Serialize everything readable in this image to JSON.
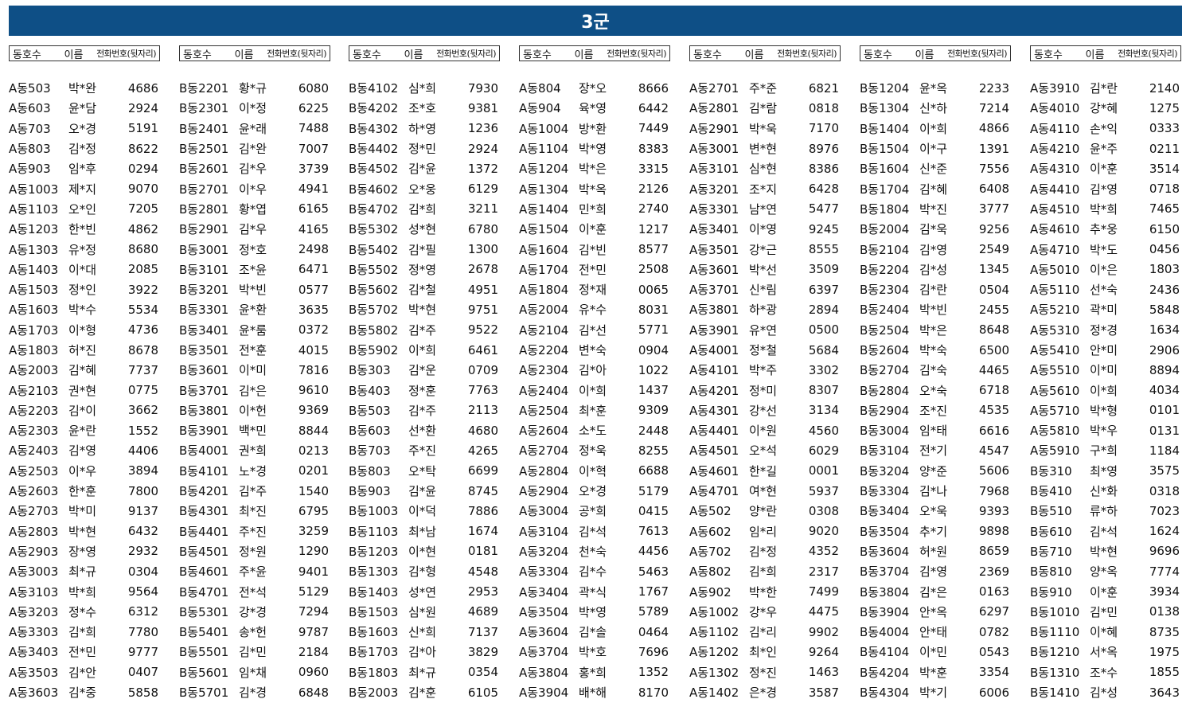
{
  "title": "3군",
  "header": {
    "unit": "동호수",
    "name": "이름",
    "phone": "전화번호(뒷자리)"
  },
  "columns": [
    [
      [
        "A동503",
        "박*완",
        "4686"
      ],
      [
        "A동603",
        "윤*담",
        "2924"
      ],
      [
        "A동703",
        "오*경",
        "5191"
      ],
      [
        "A동803",
        "김*정",
        "8622"
      ],
      [
        "A동903",
        "임*후",
        "0294"
      ],
      [
        "A동1003",
        "제*지",
        "9070"
      ],
      [
        "A동1103",
        "오*인",
        "7205"
      ],
      [
        "A동1203",
        "한*빈",
        "4862"
      ],
      [
        "A동1303",
        "유*정",
        "8680"
      ],
      [
        "A동1403",
        "이*대",
        "2085"
      ],
      [
        "A동1503",
        "정*인",
        "3922"
      ],
      [
        "A동1603",
        "박*수",
        "5534"
      ],
      [
        "A동1703",
        "이*형",
        "4736"
      ],
      [
        "A동1803",
        "허*진",
        "8678"
      ],
      [
        "A동2003",
        "김*혜",
        "7737"
      ],
      [
        "A동2103",
        "권*현",
        "0775"
      ],
      [
        "A동2203",
        "김*이",
        "3662"
      ],
      [
        "A동2303",
        "윤*란",
        "1552"
      ],
      [
        "A동2403",
        "김*영",
        "4406"
      ],
      [
        "A동2503",
        "이*우",
        "3894"
      ],
      [
        "A동2603",
        "한*훈",
        "7800"
      ],
      [
        "A동2703",
        "박*미",
        "9137"
      ],
      [
        "A동2803",
        "박*현",
        "6432"
      ],
      [
        "A동2903",
        "장*영",
        "2932"
      ],
      [
        "A동3003",
        "최*규",
        "0304"
      ],
      [
        "A동3103",
        "박*희",
        "9564"
      ],
      [
        "A동3203",
        "정*수",
        "6312"
      ],
      [
        "A동3303",
        "김*희",
        "7780"
      ],
      [
        "A동3403",
        "전*민",
        "9777"
      ],
      [
        "A동3503",
        "김*안",
        "0407"
      ],
      [
        "A동3603",
        "김*중",
        "5858"
      ]
    ],
    [
      [
        "B동2201",
        "황*규",
        "6080"
      ],
      [
        "B동2301",
        "이*정",
        "6225"
      ],
      [
        "B동2401",
        "윤*래",
        "7488"
      ],
      [
        "B동2501",
        "김*완",
        "7007"
      ],
      [
        "B동2601",
        "김*우",
        "3739"
      ],
      [
        "B동2701",
        "이*우",
        "4941"
      ],
      [
        "B동2801",
        "황*엽",
        "6165"
      ],
      [
        "B동2901",
        "김*우",
        "4165"
      ],
      [
        "B동3001",
        "정*호",
        "2498"
      ],
      [
        "B동3101",
        "조*윤",
        "6471"
      ],
      [
        "B동3201",
        "박*빈",
        "0577"
      ],
      [
        "B동3301",
        "윤*환",
        "3635"
      ],
      [
        "B동3401",
        "윤*룸",
        "0372"
      ],
      [
        "B동3501",
        "전*훈",
        "4015"
      ],
      [
        "B동3601",
        "이*미",
        "7816"
      ],
      [
        "B동3701",
        "김*은",
        "9610"
      ],
      [
        "B동3801",
        "이*헌",
        "9369"
      ],
      [
        "B동3901",
        "백*민",
        "8844"
      ],
      [
        "B동4001",
        "권*희",
        "0213"
      ],
      [
        "B동4101",
        "노*경",
        "0201"
      ],
      [
        "B동4201",
        "김*주",
        "1540"
      ],
      [
        "B동4301",
        "최*진",
        "6795"
      ],
      [
        "B동4401",
        "주*진",
        "3259"
      ],
      [
        "B동4501",
        "정*원",
        "1290"
      ],
      [
        "B동4601",
        "주*윤",
        "9401"
      ],
      [
        "B동4701",
        "전*석",
        "5129"
      ],
      [
        "B동5301",
        "강*경",
        "7294"
      ],
      [
        "B동5401",
        "송*헌",
        "9787"
      ],
      [
        "B동5501",
        "김*민",
        "2184"
      ],
      [
        "B동5601",
        "임*채",
        "0960"
      ],
      [
        "B동5701",
        "김*경",
        "6848"
      ]
    ],
    [
      [
        "B동4102",
        "심*희",
        "7930"
      ],
      [
        "B동4202",
        "조*호",
        "9381"
      ],
      [
        "B동4302",
        "하*영",
        "1236"
      ],
      [
        "B동4402",
        "정*민",
        "2924"
      ],
      [
        "B동4502",
        "김*윤",
        "1372"
      ],
      [
        "B동4602",
        "오*웅",
        "6129"
      ],
      [
        "B동4702",
        "김*희",
        "3211"
      ],
      [
        "B동5302",
        "성*현",
        "6780"
      ],
      [
        "B동5402",
        "김*필",
        "1300"
      ],
      [
        "B동5502",
        "정*영",
        "2678"
      ],
      [
        "B동5602",
        "김*철",
        "4951"
      ],
      [
        "B동5702",
        "박*현",
        "9751"
      ],
      [
        "B동5802",
        "김*주",
        "9522"
      ],
      [
        "B동5902",
        "이*희",
        "6461"
      ],
      [
        "B동303",
        "김*운",
        "0709"
      ],
      [
        "B동403",
        "정*훈",
        "7763"
      ],
      [
        "B동503",
        "김*주",
        "2113"
      ],
      [
        "B동603",
        "선*환",
        "4680"
      ],
      [
        "B동703",
        "주*진",
        "4265"
      ],
      [
        "B동803",
        "오*탁",
        "6699"
      ],
      [
        "B동903",
        "김*윤",
        "8745"
      ],
      [
        "B동1003",
        "이*덕",
        "7886"
      ],
      [
        "B동1103",
        "최*남",
        "1674"
      ],
      [
        "B동1203",
        "이*현",
        "0181"
      ],
      [
        "B동1303",
        "김*형",
        "4548"
      ],
      [
        "B동1403",
        "성*연",
        "2953"
      ],
      [
        "B동1503",
        "심*원",
        "4689"
      ],
      [
        "B동1603",
        "신*희",
        "7137"
      ],
      [
        "B동1703",
        "김*아",
        "3829"
      ],
      [
        "B동1803",
        "최*규",
        "0354"
      ],
      [
        "B동2003",
        "김*훈",
        "6105"
      ]
    ],
    [
      [
        "A동804",
        "장*오",
        "8666"
      ],
      [
        "A동904",
        "육*영",
        "6442"
      ],
      [
        "A동1004",
        "방*환",
        "7449"
      ],
      [
        "A동1104",
        "박*영",
        "8383"
      ],
      [
        "A동1204",
        "박*은",
        "3315"
      ],
      [
        "A동1304",
        "박*옥",
        "2126"
      ],
      [
        "A동1404",
        "민*희",
        "2740"
      ],
      [
        "A동1504",
        "이*훈",
        "1217"
      ],
      [
        "A동1604",
        "김*빈",
        "8577"
      ],
      [
        "A동1704",
        "전*민",
        "2508"
      ],
      [
        "A동1804",
        "정*재",
        "0065"
      ],
      [
        "A동2004",
        "유*수",
        "8031"
      ],
      [
        "A동2104",
        "김*선",
        "5771"
      ],
      [
        "A동2204",
        "변*숙",
        "0904"
      ],
      [
        "A동2304",
        "김*아",
        "1022"
      ],
      [
        "A동2404",
        "이*희",
        "1437"
      ],
      [
        "A동2504",
        "최*훈",
        "9309"
      ],
      [
        "A동2604",
        "소*도",
        "2448"
      ],
      [
        "A동2704",
        "정*욱",
        "8255"
      ],
      [
        "A동2804",
        "이*혁",
        "6688"
      ],
      [
        "A동2904",
        "오*경",
        "5179"
      ],
      [
        "A동3004",
        "공*희",
        "0415"
      ],
      [
        "A동3104",
        "김*석",
        "7613"
      ],
      [
        "A동3204",
        "천*숙",
        "4456"
      ],
      [
        "A동3304",
        "김*수",
        "5463"
      ],
      [
        "A동3404",
        "곽*식",
        "1767"
      ],
      [
        "A동3504",
        "박*영",
        "5789"
      ],
      [
        "A동3604",
        "김*솔",
        "0464"
      ],
      [
        "A동3704",
        "박*호",
        "7696"
      ],
      [
        "A동3804",
        "홍*희",
        "1352"
      ],
      [
        "A동3904",
        "배*해",
        "8170"
      ]
    ],
    [
      [
        "A동2701",
        "주*준",
        "6821"
      ],
      [
        "A동2801",
        "김*람",
        "0818"
      ],
      [
        "A동2901",
        "박*욱",
        "7170"
      ],
      [
        "A동3001",
        "변*현",
        "8976"
      ],
      [
        "A동3101",
        "심*현",
        "8386"
      ],
      [
        "A동3201",
        "조*지",
        "6428"
      ],
      [
        "A동3301",
        "남*연",
        "5477"
      ],
      [
        "A동3401",
        "이*영",
        "9245"
      ],
      [
        "A동3501",
        "강*근",
        "8555"
      ],
      [
        "A동3601",
        "박*선",
        "3509"
      ],
      [
        "A동3701",
        "신*림",
        "6397"
      ],
      [
        "A동3801",
        "하*광",
        "2894"
      ],
      [
        "A동3901",
        "유*연",
        "0500"
      ],
      [
        "A동4001",
        "정*철",
        "5684"
      ],
      [
        "A동4101",
        "박*주",
        "3302"
      ],
      [
        "A동4201",
        "정*미",
        "8307"
      ],
      [
        "A동4301",
        "강*선",
        "3134"
      ],
      [
        "A동4401",
        "이*원",
        "4560"
      ],
      [
        "A동4501",
        "오*석",
        "6029"
      ],
      [
        "A동4601",
        "한*길",
        "0001"
      ],
      [
        "A동4701",
        "여*현",
        "5937"
      ],
      [
        "A동502",
        "양*란",
        "0308"
      ],
      [
        "A동602",
        "임*리",
        "9020"
      ],
      [
        "A동702",
        "김*정",
        "4352"
      ],
      [
        "A동802",
        "김*희",
        "2317"
      ],
      [
        "A동902",
        "박*한",
        "7499"
      ],
      [
        "A동1002",
        "강*우",
        "4475"
      ],
      [
        "A동1102",
        "김*리",
        "9902"
      ],
      [
        "A동1202",
        "최*인",
        "9264"
      ],
      [
        "A동1302",
        "정*진",
        "1463"
      ],
      [
        "A동1402",
        "은*경",
        "3587"
      ]
    ],
    [
      [
        "B동1204",
        "윤*옥",
        "2233"
      ],
      [
        "B동1304",
        "신*하",
        "7214"
      ],
      [
        "B동1404",
        "이*희",
        "4866"
      ],
      [
        "B동1504",
        "이*구",
        "1391"
      ],
      [
        "B동1604",
        "신*준",
        "7556"
      ],
      [
        "B동1704",
        "김*혜",
        "6408"
      ],
      [
        "B동1804",
        "박*진",
        "3777"
      ],
      [
        "B동2004",
        "김*욱",
        "9256"
      ],
      [
        "B동2104",
        "김*영",
        "2549"
      ],
      [
        "B동2204",
        "김*성",
        "1345"
      ],
      [
        "B동2304",
        "김*란",
        "0504"
      ],
      [
        "B동2404",
        "박*빈",
        "2455"
      ],
      [
        "B동2504",
        "박*은",
        "8648"
      ],
      [
        "B동2604",
        "박*숙",
        "6500"
      ],
      [
        "B동2704",
        "김*숙",
        "4465"
      ],
      [
        "B동2804",
        "오*숙",
        "6718"
      ],
      [
        "B동2904",
        "조*진",
        "4535"
      ],
      [
        "B동3004",
        "임*태",
        "6616"
      ],
      [
        "B동3104",
        "전*기",
        "4547"
      ],
      [
        "B동3204",
        "양*준",
        "5606"
      ],
      [
        "B동3304",
        "김*나",
        "7968"
      ],
      [
        "B동3404",
        "오*욱",
        "9393"
      ],
      [
        "B동3504",
        "추*기",
        "9898"
      ],
      [
        "B동3604",
        "허*원",
        "8659"
      ],
      [
        "B동3704",
        "김*영",
        "2369"
      ],
      [
        "B동3804",
        "김*은",
        "0163"
      ],
      [
        "B동3904",
        "안*옥",
        "6297"
      ],
      [
        "B동4004",
        "안*태",
        "0782"
      ],
      [
        "B동4104",
        "이*민",
        "0543"
      ],
      [
        "B동4204",
        "박*훈",
        "3354"
      ],
      [
        "B동4304",
        "박*기",
        "6006"
      ]
    ],
    [
      [
        "A동3910",
        "김*란",
        "2140"
      ],
      [
        "A동4010",
        "강*혜",
        "1275"
      ],
      [
        "A동4110",
        "손*익",
        "0333"
      ],
      [
        "A동4210",
        "윤*주",
        "0211"
      ],
      [
        "A동4310",
        "이*훈",
        "3514"
      ],
      [
        "A동4410",
        "김*영",
        "0718"
      ],
      [
        "A동4510",
        "박*희",
        "7465"
      ],
      [
        "A동4610",
        "추*웅",
        "6150"
      ],
      [
        "A동4710",
        "박*도",
        "0456"
      ],
      [
        "A동5010",
        "이*은",
        "1803"
      ],
      [
        "A동5110",
        "선*숙",
        "2436"
      ],
      [
        "A동5210",
        "곽*미",
        "5848"
      ],
      [
        "A동5310",
        "정*경",
        "1634"
      ],
      [
        "A동5410",
        "안*미",
        "2906"
      ],
      [
        "A동5510",
        "이*미",
        "8894"
      ],
      [
        "A동5610",
        "이*희",
        "4034"
      ],
      [
        "A동5710",
        "박*형",
        "0101"
      ],
      [
        "A동5810",
        "박*우",
        "0131"
      ],
      [
        "A동5910",
        "구*희",
        "1184"
      ],
      [
        "B동310",
        "최*영",
        "3575"
      ],
      [
        "B동410",
        "신*화",
        "0318"
      ],
      [
        "B동510",
        "류*하",
        "7023"
      ],
      [
        "B동610",
        "김*석",
        "1624"
      ],
      [
        "B동710",
        "박*현",
        "9696"
      ],
      [
        "B동810",
        "양*옥",
        "7774"
      ],
      [
        "B동910",
        "이*훈",
        "3934"
      ],
      [
        "B동1010",
        "김*민",
        "0138"
      ],
      [
        "B동1110",
        "이*혜",
        "8735"
      ],
      [
        "B동1210",
        "서*옥",
        "1975"
      ],
      [
        "B동1310",
        "조*수",
        "1855"
      ],
      [
        "B동1410",
        "김*성",
        "3643"
      ]
    ]
  ]
}
